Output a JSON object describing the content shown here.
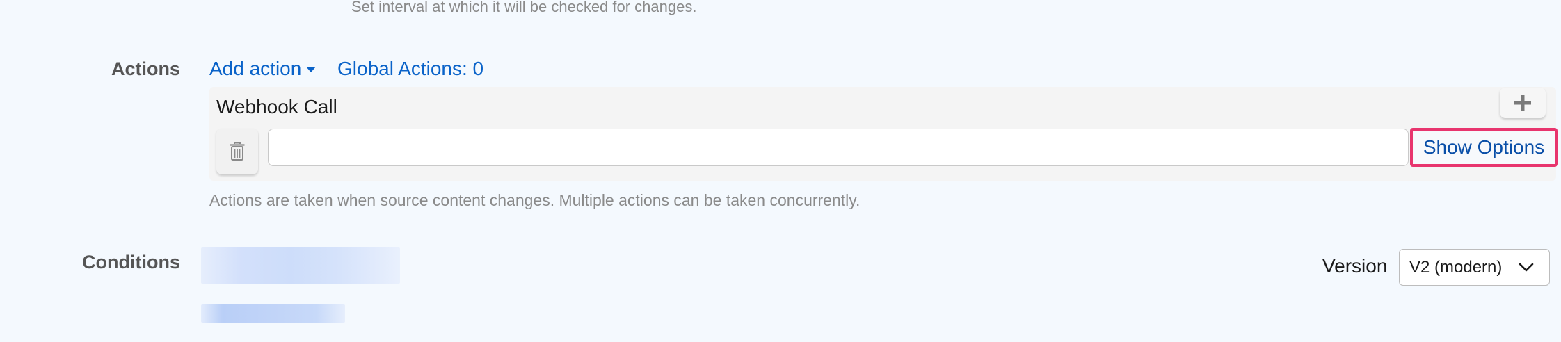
{
  "interval": {
    "hint": "Set interval at which it will be checked for changes."
  },
  "actions": {
    "label": "Actions",
    "add_action": "Add action",
    "global_actions": "Global Actions: 0",
    "items": [
      {
        "title": "Webhook Call",
        "input_value": "",
        "show_options_label": "Show Options"
      }
    ],
    "hint": "Actions are taken when source content changes. Multiple actions can be taken concurrently."
  },
  "conditions": {
    "label": "Conditions",
    "version_label": "Version",
    "version_selected": "V2 (modern)"
  },
  "icons": {
    "add_caret": "caret-down-icon",
    "plus": "plus-icon",
    "delete": "trash-icon",
    "select": "chevron-down-icon"
  },
  "colors": {
    "background": "#f4f9fe",
    "link": "#0a63c9",
    "highlight_border": "#e8356e",
    "muted_text": "#8a8a8a"
  }
}
